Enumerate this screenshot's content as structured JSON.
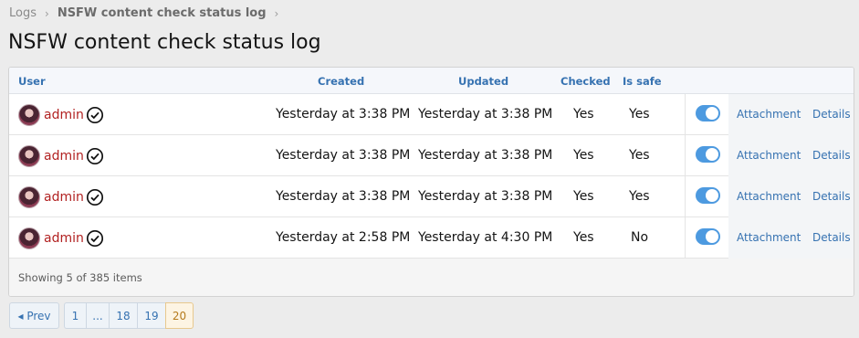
{
  "breadcrumb": {
    "root": "Logs",
    "current": "NSFW content check status log"
  },
  "page_title": "NSFW content check status log",
  "table": {
    "columns": {
      "user": "User",
      "created": "Created",
      "updated": "Updated",
      "checked": "Checked",
      "is_safe": "Is safe"
    },
    "rows": [
      {
        "user": "admin",
        "created": "Yesterday at 3:38 PM",
        "updated": "Yesterday at 3:38 PM",
        "checked": "Yes",
        "is_safe": "Yes",
        "enabled": true,
        "attachment": "Attachment",
        "details": "Details"
      },
      {
        "user": "admin",
        "created": "Yesterday at 3:38 PM",
        "updated": "Yesterday at 3:38 PM",
        "checked": "Yes",
        "is_safe": "Yes",
        "enabled": true,
        "attachment": "Attachment",
        "details": "Details"
      },
      {
        "user": "admin",
        "created": "Yesterday at 3:38 PM",
        "updated": "Yesterday at 3:38 PM",
        "checked": "Yes",
        "is_safe": "Yes",
        "enabled": true,
        "attachment": "Attachment",
        "details": "Details"
      },
      {
        "user": "admin",
        "created": "Yesterday at 2:58 PM",
        "updated": "Yesterday at 4:30 PM",
        "checked": "Yes",
        "is_safe": "No",
        "enabled": true,
        "attachment": "Attachment",
        "details": "Details"
      }
    ],
    "footer": "Showing 5 of 385 items"
  },
  "pagination": {
    "prev": "◂ Prev",
    "pages": [
      "1",
      "...",
      "18",
      "19",
      "20"
    ],
    "current": "20"
  },
  "colors": {
    "accent": "#3672b1",
    "username": "#b22222",
    "toggle_on": "#4d9ae0",
    "current_page_bg": "#fdf4e3"
  },
  "icons": {
    "verified": "check-circle-icon",
    "crumb_separator": "chevron-right-icon"
  }
}
